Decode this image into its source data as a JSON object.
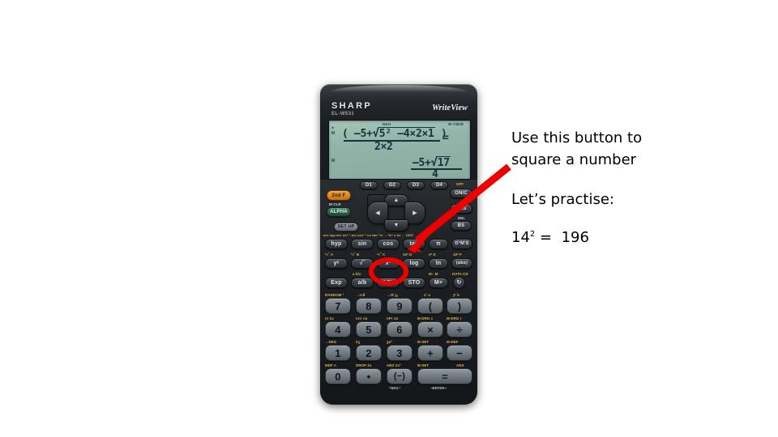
{
  "slide": {
    "background_color": "#ffffff",
    "annotation_color": "#ef0000"
  },
  "instruction": {
    "line1": "Use this button to",
    "line2": "square a number",
    "prompt": "Let’s practise:",
    "practice_base": "14",
    "practice_exponent": "2",
    "practice_equals": "=",
    "practice_answer": "196"
  },
  "calculator": {
    "brand": "SHARP",
    "model": "EL-W531",
    "tagline": "WriteView",
    "display": {
      "indicator_deg": "DEG",
      "indicator_wview": "W-VIEW",
      "indicator_plus": "+",
      "indicator_m": "M",
      "indicator_m_lower": "M",
      "expr_open": "( –5+",
      "expr_radicand": "5² –4×2×1",
      "expr_close": " )",
      "expr_denominator": "2×2",
      "equals": "=",
      "result_numerator_prefix": "–5+",
      "result_radicand": "17",
      "result_denominator": "4"
    },
    "keys": {
      "function_row_top": [
        {
          "label": "D1",
          "above": ""
        },
        {
          "label": "D2",
          "above": ""
        },
        {
          "label": "D3",
          "above": ""
        },
        {
          "label": "D4",
          "above": ""
        }
      ],
      "mode_keys": [
        {
          "label": "2nd F",
          "color": "orange"
        },
        {
          "label": "M-CLR",
          "color": "white"
        },
        {
          "label": "ALPHA",
          "color": "green"
        },
        {
          "label": "SET UP",
          "color": "gray"
        }
      ],
      "power_keys": [
        {
          "label": "OFF",
          "above": true
        },
        {
          "label": "ON/C"
        },
        {
          "label": "ANS"
        },
        {
          "label": "DEL",
          "above": true
        },
        {
          "label": "BS"
        }
      ],
      "trig_row_above": "arc hyp arc sin⁻¹ arc cos⁻¹ cn   tan⁻¹π   → %÷ x on → DEG",
      "trig_row": [
        "hyp",
        "sin",
        "cos",
        "tan",
        "π",
        "D°M’S"
      ],
      "power_row_above": [
        "ˣ√‾  A",
        "³√‾  B",
        "ˣ√‾  C",
        "10ˣ  D",
        "eˣ  E",
        "10ˣ  F"
      ],
      "power_row": [
        "yˣ",
        "√‾",
        "x²",
        "log",
        "ln",
        "(abs)"
      ],
      "memory_row_above": [
        "→",
        "a b/c",
        "",
        "",
        "M−   M",
        "DATA  CD"
      ],
      "memory_row": [
        "Exp",
        "a/b",
        "RCL",
        "STO",
        "M+",
        "↻"
      ],
      "numeric_rows": [
        {
          "above": [
            "RANDOM  ³",
            "→rcθ",
            "→rθ  χᵧ",
            "x¹  a",
            "yʳ  b"
          ],
          "keys": [
            "7",
            "8",
            "9",
            "(",
            ")"
          ]
        },
        {
          "above": [
            "n!  Σx",
            "nCr  nx",
            "nPr  σx",
            "M-DRG  c",
            "M-DRG  r"
          ],
          "keys": [
            "4",
            "5",
            "6",
            "×",
            "÷"
          ]
        },
        {
          "above": [
            "→DEG",
            "Σχ",
            "χσ²",
            "M-SET",
            "M-DEF"
          ],
          "keys": [
            "1",
            "2",
            "3",
            "+",
            "−"
          ]
        },
        {
          "above": [
            "MDF  n",
            "DROP  Σx",
            "ABS  Σx²",
            "M-SET",
            "ANS"
          ],
          "keys": [
            "0",
            "•",
            "(−)",
            "="
          ]
        }
      ],
      "neg_caption": "└NEG┘",
      "enter_caption": "¬ENTER¬"
    },
    "highlighted_key": "x²"
  }
}
